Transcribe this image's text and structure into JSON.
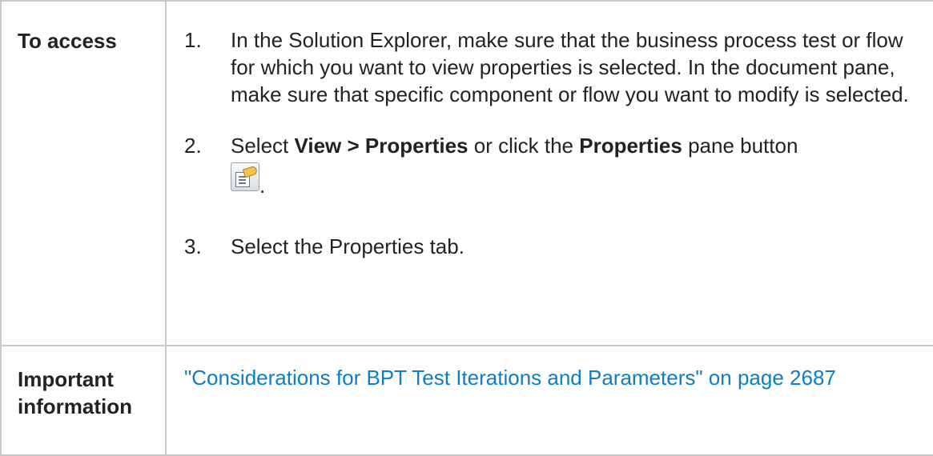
{
  "rows": {
    "access": {
      "label": "To access",
      "steps": [
        {
          "number": "1.",
          "text": "In the Solution Explorer, make sure that the business process test or flow for which you want to view properties is selected. In the document pane, make sure that specific component or flow you want to modify is selected."
        },
        {
          "number": "2.",
          "parts": [
            "Select ",
            "View > Properties",
            " or click the ",
            "Properties",
            " pane button"
          ],
          "icon": "properties-pane-icon",
          "trailing": "."
        },
        {
          "number": "3.",
          "text": "Select the Properties tab."
        }
      ]
    },
    "important": {
      "label": "Important information",
      "link_text": "\"Considerations for BPT Test Iterations and Parameters\" on page 2687"
    }
  },
  "colors": {
    "link": "#0f7dc2",
    "border": "#c8c8c8",
    "text": "#222222"
  }
}
